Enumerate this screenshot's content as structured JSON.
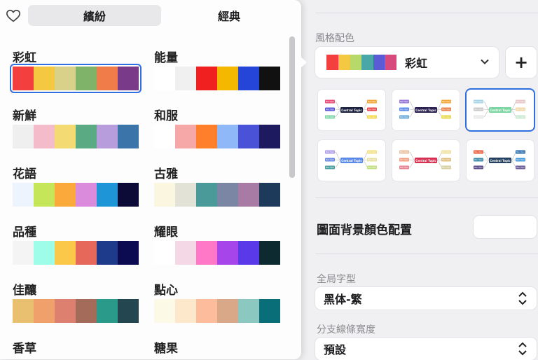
{
  "settings": {
    "style_color_label": "風格配色",
    "current_palette_name": "彩虹",
    "current_palette_colors": [
      "#f43f3f",
      "#f5c842",
      "#b7d96a",
      "#4aa7a8",
      "#5b5bd6",
      "#d64a7d"
    ],
    "add_button_label": "+",
    "background_color_label": "圖面背景顏色配置",
    "font_label": "全局字型",
    "font_value": "黑体-繁",
    "branch_width_label": "分支線條寬度",
    "branch_width_value": "預設",
    "central_topic_text": "Central Topic",
    "main_topic_text": "Main Topic"
  },
  "popover": {
    "tabs": [
      {
        "label": "繽紛",
        "active": true
      },
      {
        "label": "經典",
        "active": false
      }
    ],
    "palettes": [
      {
        "name": "彩虹",
        "colors": [
          "#f43f3f",
          "#f5c842",
          "#d9d08a",
          "#7fb36a",
          "#f07c4a",
          "#7a3a8a"
        ],
        "selected": true
      },
      {
        "name": "能量",
        "colors": [
          "#ffffff",
          "#f0f0f0",
          "#f02020",
          "#f5b800",
          "#2544d8",
          "#111111"
        ]
      },
      {
        "name": "新鮮",
        "colors": [
          "#efefef",
          "#f4bccb",
          "#f4da72",
          "#5aaa84",
          "#b79ddc",
          "#3a74a8"
        ]
      },
      {
        "name": "和服",
        "colors": [
          "#ffffff",
          "#f6a8a8",
          "#ff7f2a",
          "#8fb8f8",
          "#4a53d8",
          "#1e1a60"
        ]
      },
      {
        "name": "花語",
        "colors": [
          "#eef4fe",
          "#c6e65a",
          "#fca93c",
          "#da8bdc",
          "#1e95d6",
          "#0c0a36"
        ]
      },
      {
        "name": "古雅",
        "colors": [
          "#faf6e0",
          "#e2e2d6",
          "#4b9a9a",
          "#7a86a4",
          "#a87ba4",
          "#1e3a5a"
        ]
      },
      {
        "name": "品種",
        "colors": [
          "#f4f4f4",
          "#9efde8",
          "#fbc84a",
          "#e5685a",
          "#1e3a8a",
          "#0c0a50"
        ]
      },
      {
        "name": "耀眼",
        "colors": [
          "#ffffff",
          "#f4d8e6",
          "#ff78c8",
          "#a545ea",
          "#5a3ae8",
          "#0c2a30"
        ]
      },
      {
        "name": "佳釀",
        "colors": [
          "#e8c070",
          "#f0a06a",
          "#de8070",
          "#a46a5a",
          "#2a9a8a",
          "#234650"
        ]
      },
      {
        "name": "點心",
        "colors": [
          "#fcfae6",
          "#fde8cc",
          "#fdbc9c",
          "#d9a888",
          "#8ac8c0",
          "#0a6e78"
        ]
      },
      {
        "name": "香草",
        "colors": []
      },
      {
        "name": "糖果",
        "colors": []
      }
    ]
  },
  "thumb_themes": [
    {
      "central": "#1a2040",
      "branches": [
        "#e8507a",
        "#5a5ad8",
        "#7fd6a8",
        "#f5a83a",
        "#e84a4a",
        "#f5d84a"
      ],
      "selected": false
    },
    {
      "central": "#2a2050",
      "branches": [
        "#9a7ad8",
        "#5a8ae8",
        "#6aa8d8",
        "#f5a83a",
        "#e8804a",
        "#e8d84a"
      ],
      "selected": false
    },
    {
      "central": "#7ad6a0",
      "branches": [
        "#a8d6e8",
        "#c8c8c8",
        "#e8e8e8",
        "#e8c8c8",
        "#f0d8a8",
        "#c8e8d0"
      ],
      "selected": true
    },
    {
      "central": "#5a8ae8",
      "branches": [
        "#b0a0e8",
        "#6a8ae0",
        "#4aa0a0",
        "#f0e080",
        "#e8e0a0",
        "#c0e080"
      ],
      "selected": false
    },
    {
      "central": "#d83050",
      "branches": [
        "#e8c0a0",
        "#f0a080",
        "#e88090",
        "#f0e0a0",
        "#e0c080",
        "#d8d0a0"
      ],
      "selected": false
    },
    {
      "central": "#234060",
      "branches": [
        "#e85a3a",
        "#3a8aa8",
        "#5a4a8a",
        "#2a6aa8",
        "#4a9ad8",
        "#6a5a9a"
      ],
      "selected": false
    }
  ]
}
